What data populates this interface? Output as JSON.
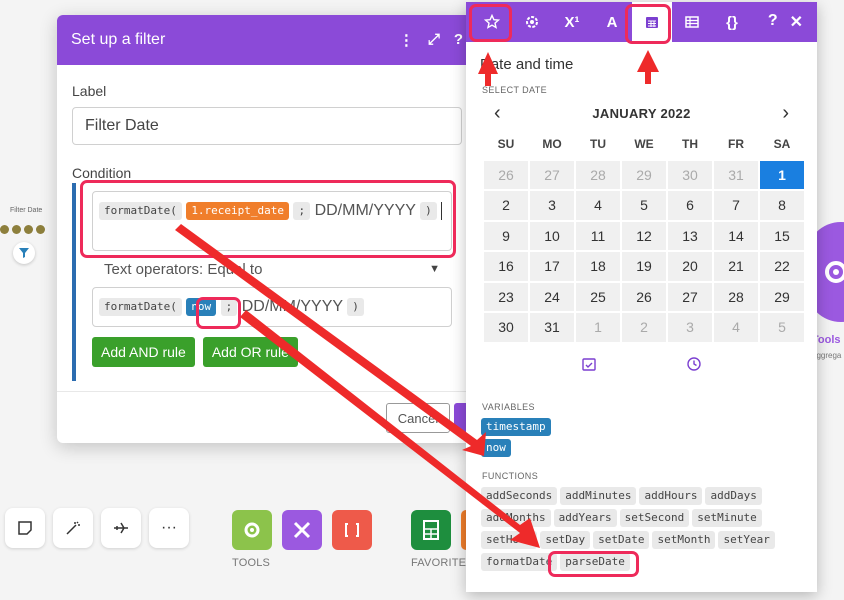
{
  "canvas": {
    "node_label": "Filter Date",
    "tools_title": "Tools",
    "tools_subtitle": "aggrega",
    "bottom_bar": {
      "category_tools": "TOOLS",
      "category_favorites": "FAVORITES",
      "more_label": "···"
    }
  },
  "dialog": {
    "title": "Set up a filter",
    "label_field_label": "Label",
    "label_value": "Filter Date",
    "condition_label": "Condition",
    "formula1": {
      "fn_open": "formatDate(",
      "variable": "1.receipt_date",
      "separator": ";",
      "format": "DD/MM/YYYY",
      "fn_close": ")"
    },
    "operator": "Text operators: Equal to",
    "formula2": {
      "fn_open": "formatDate(",
      "variable": "now",
      "separator": ";",
      "format": "DD/MM/YYYY",
      "fn_close": ")"
    },
    "add_and_rule": "Add AND rule",
    "add_or_rule": "Add OR rule",
    "cancel_label": "Cancel"
  },
  "panel": {
    "toolbar": {
      "superscript_label": "X¹",
      "text_label": "A",
      "json_label": "{}",
      "help_label": "?",
      "close_label": "✕"
    },
    "title": "Date and time",
    "select_date_label": "SELECT DATE",
    "calendar": {
      "month": "JANUARY 2022",
      "prev": "‹",
      "next": "›",
      "weekdays": [
        "SU",
        "MO",
        "TU",
        "WE",
        "TH",
        "FR",
        "SA"
      ],
      "weeks": [
        [
          "26",
          "27",
          "28",
          "29",
          "30",
          "31",
          "1"
        ],
        [
          "2",
          "3",
          "4",
          "5",
          "6",
          "7",
          "8"
        ],
        [
          "9",
          "10",
          "11",
          "12",
          "13",
          "14",
          "15"
        ],
        [
          "16",
          "17",
          "18",
          "19",
          "20",
          "21",
          "22"
        ],
        [
          "23",
          "24",
          "25",
          "26",
          "27",
          "28",
          "29"
        ],
        [
          "30",
          "31",
          "1",
          "2",
          "3",
          "4",
          "5"
        ]
      ],
      "selected": "1"
    },
    "variables_label": "VARIABLES",
    "variables": [
      "timestamp",
      "now"
    ],
    "functions_label": "FUNCTIONS",
    "functions": [
      "addSeconds",
      "addMinutes",
      "addHours",
      "addDays",
      "addMonths",
      "addYears",
      "setSecond",
      "setMinute",
      "setHour",
      "setDay",
      "setDate",
      "setMonth",
      "setYear",
      "formatDate",
      "parseDate"
    ]
  },
  "colors": {
    "accent_purple": "#8b4ad8",
    "highlight_red": "#ee2a5a",
    "selected_blue": "#1a7fe0",
    "token_orange": "#f07e2b",
    "token_blue": "#2980b9",
    "button_green": "#3aa02b"
  }
}
